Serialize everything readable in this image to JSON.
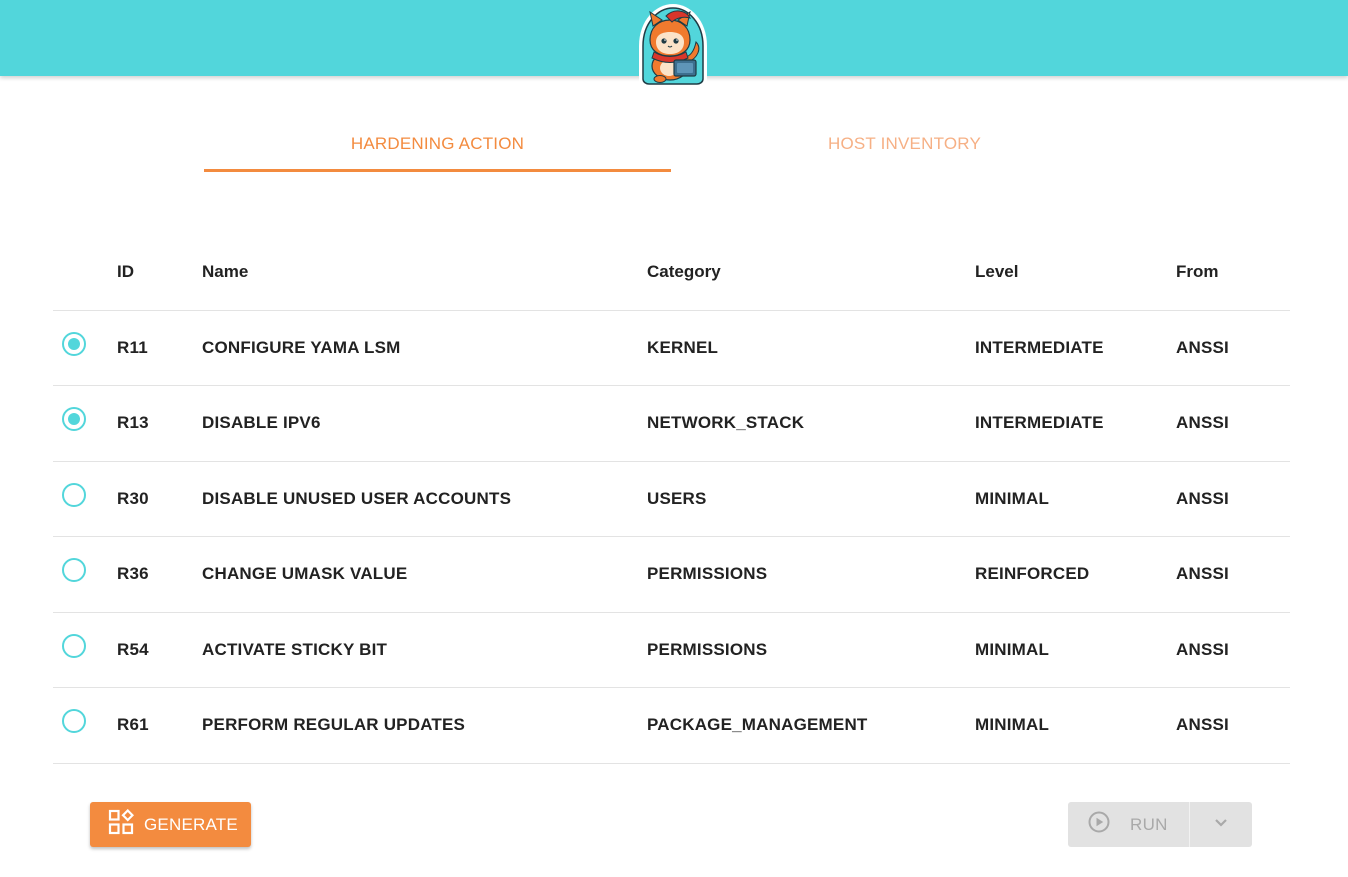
{
  "header": {
    "logo_icon": "fox-mascot-laptop-logo"
  },
  "tabs": [
    {
      "label": "HARDENING ACTION",
      "active": true
    },
    {
      "label": "HOST INVENTORY",
      "active": false
    }
  ],
  "table": {
    "columns": [
      "",
      "ID",
      "Name",
      "Category",
      "Level",
      "From"
    ],
    "rows": [
      {
        "selected": true,
        "id": "R11",
        "name": "CONFIGURE YAMA LSM",
        "category": "KERNEL",
        "level": "INTERMEDIATE",
        "from": "ANSSI"
      },
      {
        "selected": true,
        "id": "R13",
        "name": "DISABLE IPV6",
        "category": "NETWORK_STACK",
        "level": "INTERMEDIATE",
        "from": "ANSSI"
      },
      {
        "selected": false,
        "id": "R30",
        "name": "DISABLE UNUSED USER ACCOUNTS",
        "category": "USERS",
        "level": "MINIMAL",
        "from": "ANSSI"
      },
      {
        "selected": false,
        "id": "R36",
        "name": "CHANGE UMASK VALUE",
        "category": "PERMISSIONS",
        "level": "REINFORCED",
        "from": "ANSSI"
      },
      {
        "selected": false,
        "id": "R54",
        "name": "ACTIVATE STICKY BIT",
        "category": "PERMISSIONS",
        "level": "MINIMAL",
        "from": "ANSSI"
      },
      {
        "selected": false,
        "id": "R61",
        "name": "PERFORM REGULAR UPDATES",
        "category": "PACKAGE_MANAGEMENT",
        "level": "MINIMAL",
        "from": "ANSSI"
      }
    ]
  },
  "actions": {
    "generate_label": "GENERATE",
    "generate_icon": "widgets-icon",
    "run_label": "RUN",
    "run_icon": "play-circle-icon",
    "run_disabled": true,
    "dropdown_icon": "chevron-down-icon"
  },
  "colors": {
    "header_bg": "#52d6db",
    "accent": "#f38b3f",
    "radio": "#52d6db",
    "disabled_bg": "#e2e2e2"
  }
}
